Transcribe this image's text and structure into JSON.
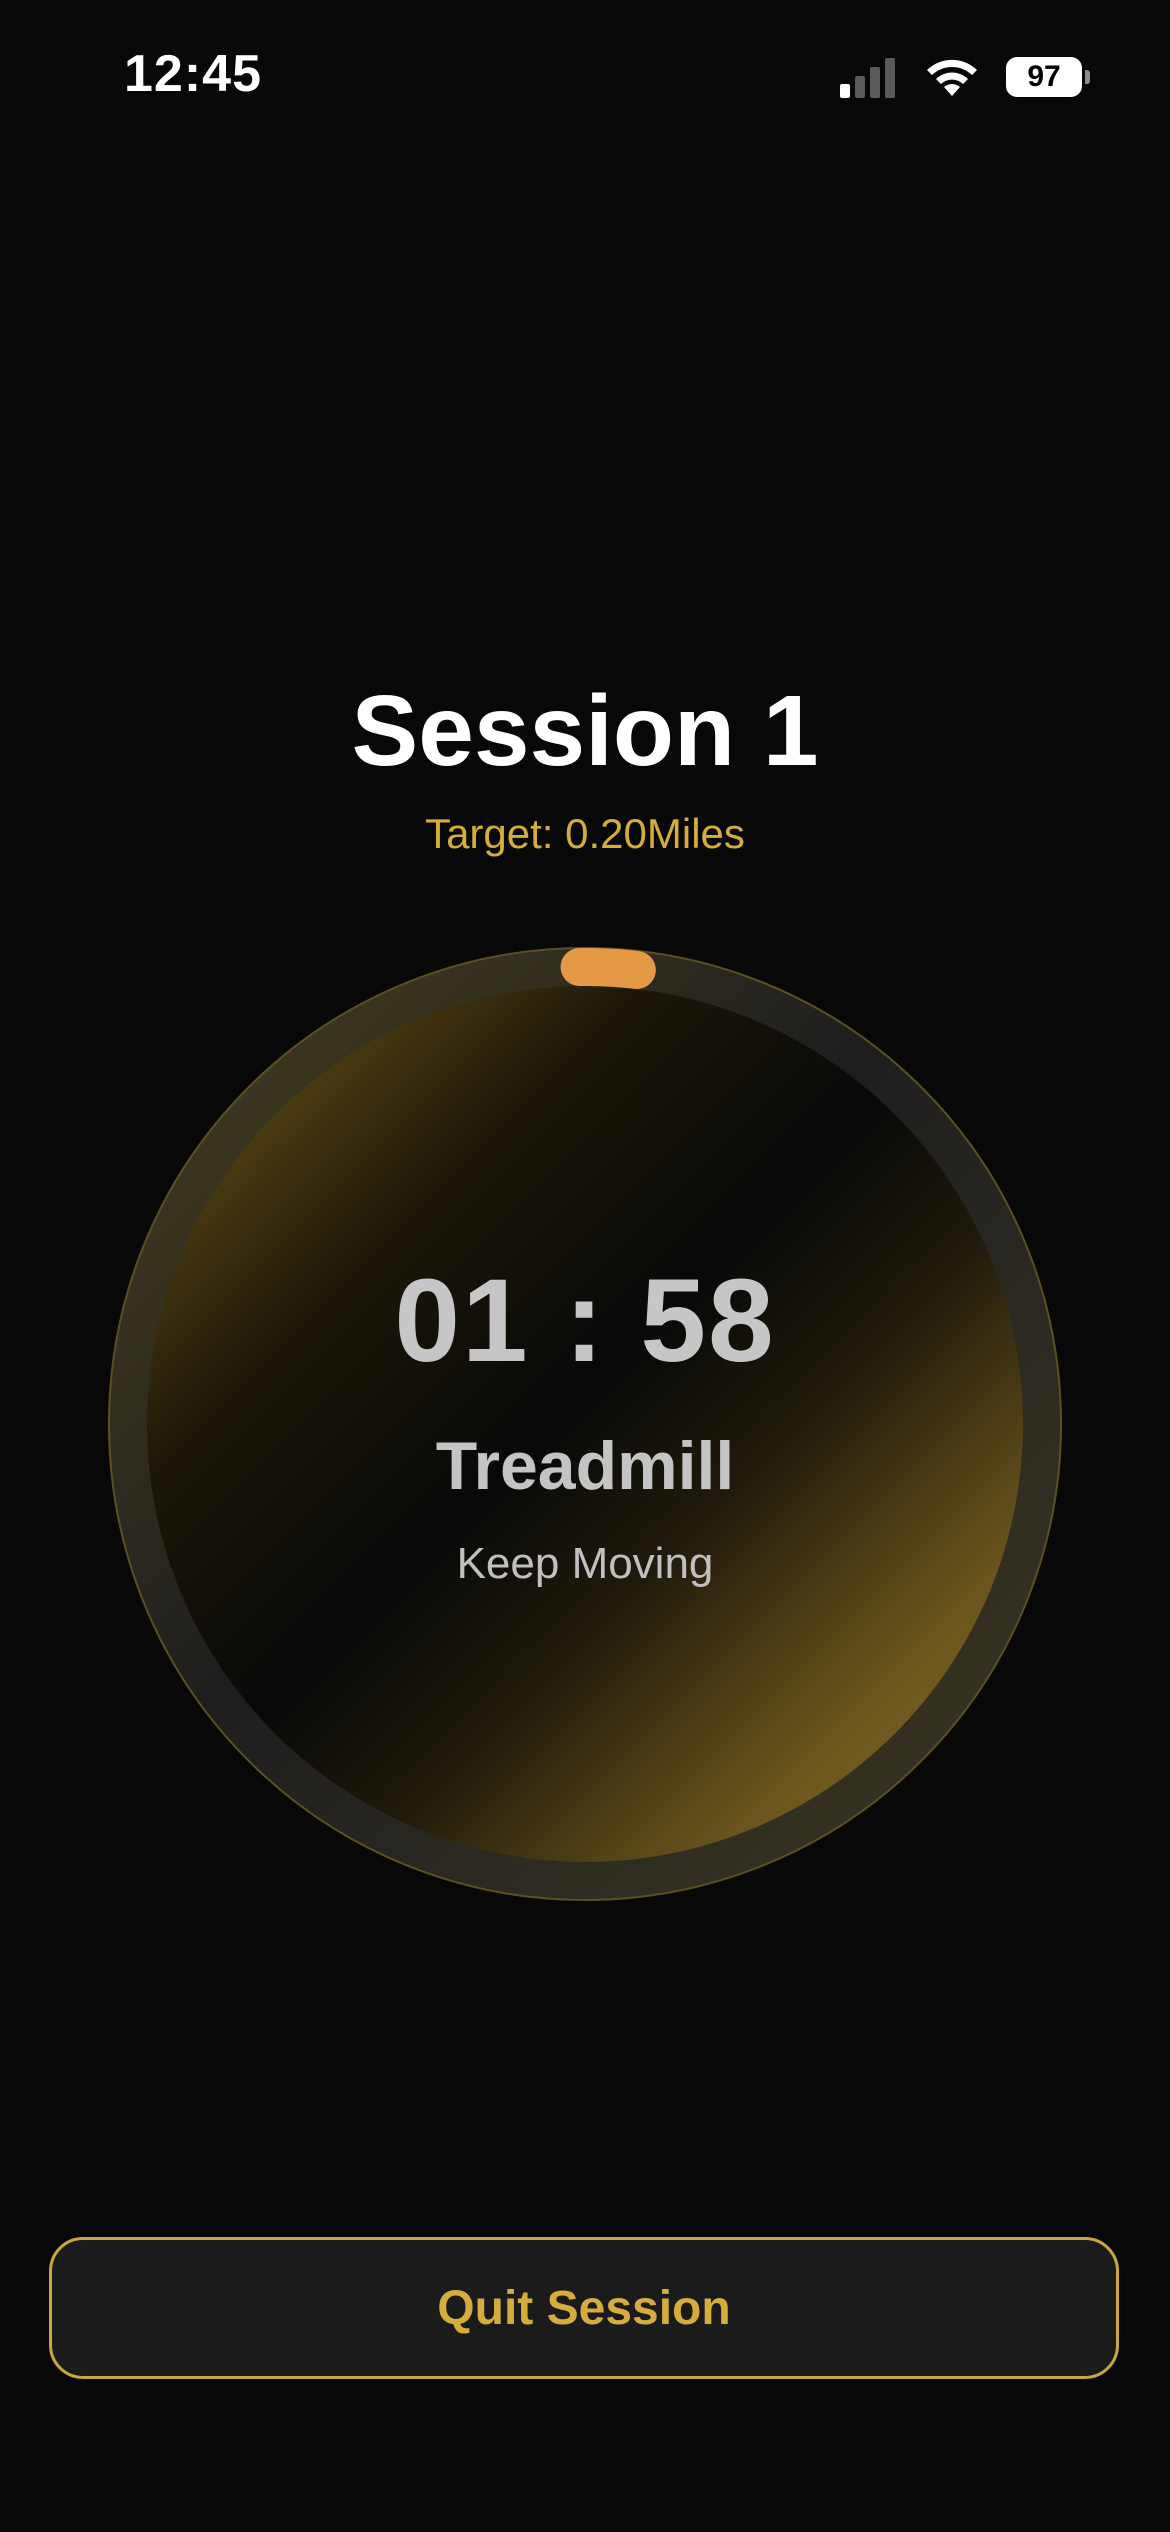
{
  "status_bar": {
    "time": "12:45",
    "battery_level": "97",
    "signal_icon": "cellular-signal-icon",
    "wifi_icon": "wifi-icon"
  },
  "session": {
    "title": "Session 1",
    "target": "Target: 0.20Miles"
  },
  "timer": {
    "time": "01 : 58",
    "activity": "Treadmill",
    "message": "Keep Moving",
    "progress_fraction": 0.02
  },
  "actions": {
    "quit_label": "Quit Session"
  },
  "colors": {
    "background": "#080808",
    "accent_gold": "#d4ad3c",
    "progress_orange": "#e49a45",
    "ring_track": "#2a2a2a",
    "button_bg": "#1b1b1b"
  }
}
